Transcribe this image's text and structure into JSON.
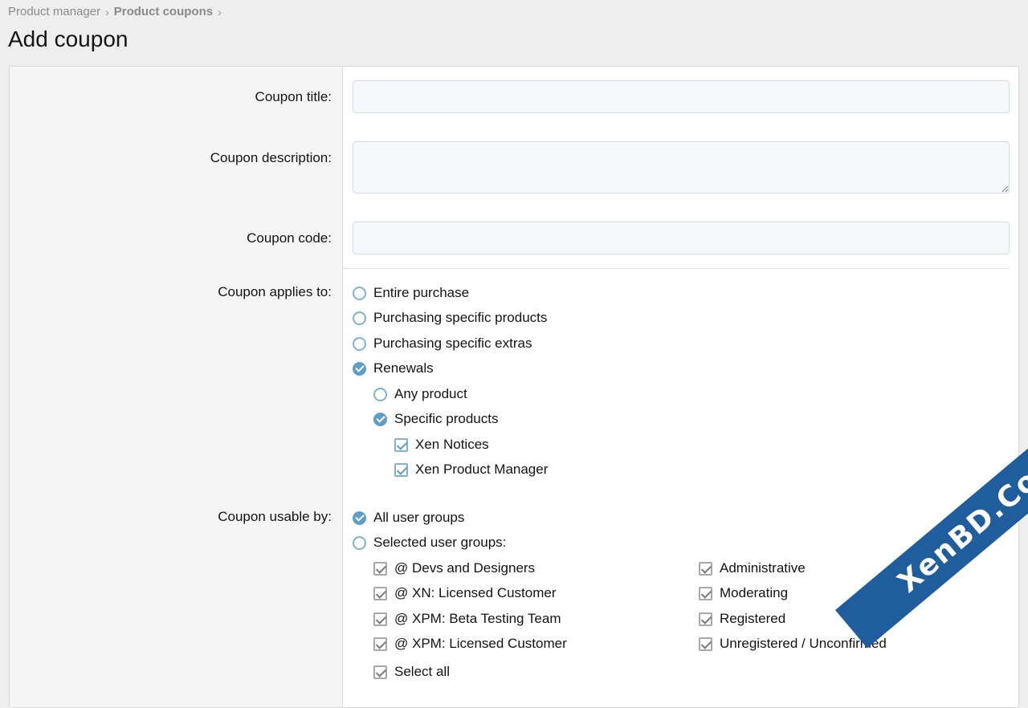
{
  "breadcrumb": {
    "item1": "Product manager",
    "item2": "Product coupons",
    "separator": "›"
  },
  "page": {
    "title": "Add coupon"
  },
  "form": {
    "title_label": "Coupon title:",
    "title_value": "",
    "description_label": "Coupon description:",
    "description_value": "",
    "code_label": "Coupon code:",
    "code_value": "",
    "applies_label": "Coupon applies to:",
    "applies_options": {
      "entire": "Entire purchase",
      "products": "Purchasing specific products",
      "extras": "Purchasing specific extras",
      "renewals": "Renewals"
    },
    "renewals_options": {
      "any": "Any product",
      "specific": "Specific products"
    },
    "renewal_products": [
      "Xen Notices",
      "Xen Product Manager"
    ],
    "usable_label": "Coupon usable by:",
    "usable_options": {
      "all": "All user groups",
      "selected": "Selected user groups:"
    },
    "groups_left": [
      "@ Devs and Designers",
      "@ XN: Licensed Customer",
      "@ XPM: Beta Testing Team",
      "@ XPM: Licensed Customer"
    ],
    "groups_right": [
      "Administrative",
      "Moderating",
      "Registered",
      "Unregistered / Unconfirmed"
    ],
    "select_all": "Select all"
  },
  "watermark": "XenBD.Com",
  "colors": {
    "accent": "#5e9ec9",
    "watermark_bg": "#1f5d9c"
  }
}
